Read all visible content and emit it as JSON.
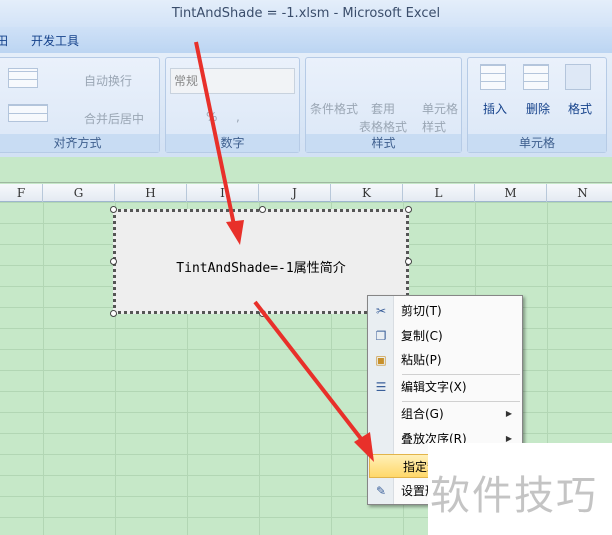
{
  "window": {
    "title": "TintAndShade = -1.xlsm - Microsoft Excel"
  },
  "tabs": [
    {
      "label": "田"
    },
    {
      "label": "开发工具"
    }
  ],
  "ribbon": {
    "alignment": {
      "label": "对齐方式",
      "wrap": "自动换行",
      "merge": "合并后居中"
    },
    "number": {
      "label": "数字",
      "format": "常规",
      "percent": "%",
      "comma": ","
    },
    "styles": {
      "label": "样式",
      "conditional": "条件格式",
      "table1": "套用",
      "table2": "表格格式",
      "cell1": "单元格",
      "cell2": "样式"
    },
    "cells": {
      "label": "单元格",
      "insert": "插入",
      "delete": "删除",
      "format": "格式"
    }
  },
  "columns": [
    "F",
    "G",
    "H",
    "I",
    "J",
    "K",
    "L",
    "M",
    "N"
  ],
  "shape": {
    "text": "TintAndShade=-1属性简介"
  },
  "context_menu": {
    "items": [
      {
        "label": "剪切(T)",
        "icon": "scissors-icon"
      },
      {
        "label": "复制(C)",
        "icon": "copy-icon"
      },
      {
        "label": "粘贴(P)",
        "icon": "paste-icon"
      },
      {
        "label": "编辑文字(X)",
        "icon": "edit-text-icon"
      },
      {
        "label": "组合(G)",
        "submenu": true
      },
      {
        "label": "叠放次序(R)",
        "submenu": true
      },
      {
        "label": "指定宏",
        "highlighted": true
      },
      {
        "label": "设置形状格式",
        "icon": "format-shape-icon"
      }
    ]
  },
  "watermark": "软件技巧",
  "colors": {
    "arrow": "#e8302a",
    "grid": "#c6e8c8",
    "highlight": "#ffd86a"
  }
}
